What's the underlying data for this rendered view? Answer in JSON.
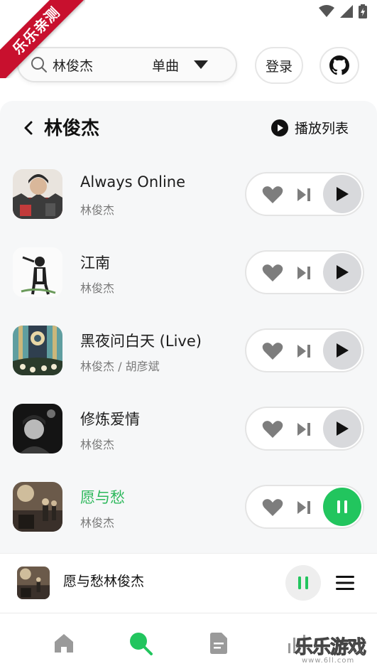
{
  "watermark_ribbon": "乐乐亲测",
  "search": {
    "query": "林俊杰",
    "scope": "单曲"
  },
  "header": {
    "login_label": "登录"
  },
  "panel": {
    "artist": "林俊杰",
    "playlist_label": "播放列表"
  },
  "songs": [
    {
      "title": "Always Online",
      "artist": "林俊杰",
      "playing": false
    },
    {
      "title": "江南",
      "artist": "林俊杰",
      "playing": false
    },
    {
      "title": "黑夜问白天 (Live)",
      "artist": "林俊杰 / 胡彦斌",
      "playing": false
    },
    {
      "title": "修炼爱情",
      "artist": "林俊杰",
      "playing": false
    },
    {
      "title": "愿与愁",
      "artist": "林俊杰",
      "playing": true
    }
  ],
  "now_playing": {
    "title": "愿与愁林俊杰"
  },
  "nav": {
    "active": "search",
    "items": [
      "home-icon",
      "search-icon",
      "document-icon",
      "stats-icon"
    ]
  },
  "site_watermark": {
    "text": "乐乐游戏",
    "url": "www.6ll.com"
  },
  "colors": {
    "accent": "#22c55e",
    "ribbon": "#c8102e",
    "panel_bg": "#f6f7f8"
  }
}
